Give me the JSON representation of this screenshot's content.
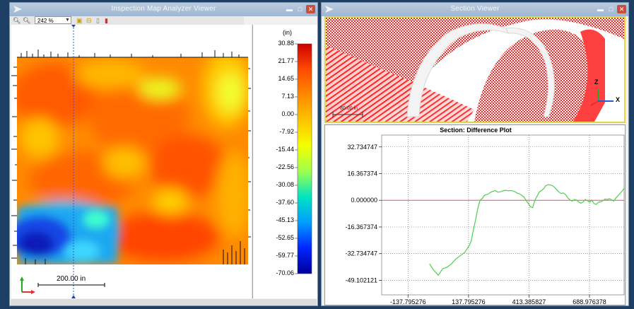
{
  "left_window": {
    "title": "Inspection Map Analyzer Viewer",
    "zoom_value": "242 %",
    "legend_unit": "(in)",
    "legend_ticks": [
      "30.88",
      "21.77",
      "14.65",
      "7.13",
      "0.00",
      "-7.92",
      "-15.44",
      "-22.56",
      "-30.08",
      "-37.60",
      "-45.13",
      "-52.65",
      "-59.77",
      "-70.06"
    ],
    "legend_colors": [
      "#cc0000",
      "#ff4a00",
      "#ff8a00",
      "#ffc400",
      "#f4ff00",
      "#9cff4f",
      "#00e3c2",
      "#009dff",
      "#0024ff",
      "#00009a"
    ],
    "scale_bar_label": "200.00 in"
  },
  "right_window": {
    "title": "Section Viewer",
    "view_scale_label": "80.00 in",
    "axis_z_label": "Z",
    "axis_x_label": "X",
    "plot": {
      "title": "Section: Difference Plot"
    }
  },
  "chart_data": {
    "type": "line",
    "title": "Section: Difference Plot",
    "xlabel": "",
    "ylabel": "",
    "x_ticks": [
      "-137.795276",
      "137.795276",
      "413.385827",
      "688.976378"
    ],
    "y_ticks": [
      "32.734747",
      "16.367374",
      "0.000000",
      "-16.367374",
      "-32.734747",
      "-49.102121"
    ],
    "xlim": [
      -258,
      850
    ],
    "ylim": [
      -58,
      40
    ],
    "series": [
      {
        "color": "#4dd04d",
        "x": [
          -40,
          -20,
          0,
          20,
          40,
          60,
          80,
          100,
          120,
          140,
          150,
          160,
          170,
          180,
          190,
          200,
          210,
          220,
          230,
          240,
          250,
          260,
          270,
          280,
          290,
          300,
          310,
          320,
          330,
          340,
          350,
          360,
          370,
          380,
          390,
          400,
          410,
          420,
          430,
          440,
          450,
          460,
          470,
          480,
          490,
          500,
          510,
          520,
          530,
          540,
          550,
          560,
          570,
          580,
          590,
          600,
          610,
          620,
          630,
          640,
          650,
          660,
          670,
          680,
          690,
          700,
          710,
          720,
          730,
          740,
          750,
          760,
          770,
          780,
          790,
          800,
          810,
          820,
          830,
          840,
          848
        ],
        "y": [
          -39,
          -43,
          -46,
          -42,
          -41,
          -39,
          -36,
          -34,
          -32,
          -28,
          -25,
          -18,
          -12,
          -5,
          0,
          1,
          3,
          3.5,
          4,
          5,
          5.5,
          6,
          5,
          5.2,
          5.5,
          6,
          6.1,
          5.8,
          6,
          5.7,
          5.2,
          4.3,
          4,
          3,
          2,
          0,
          -2,
          -4,
          -4.5,
          0,
          2.5,
          5,
          6,
          7,
          9,
          9.5,
          9.4,
          9,
          8,
          6.5,
          5,
          4.2,
          4.5,
          3.5,
          1.5,
          0.2,
          -0.5,
          0.5,
          0.1,
          -1,
          -1.8,
          -1,
          0.5,
          -0.3,
          -1.2,
          0,
          -2,
          -2.5,
          -1.2,
          -1,
          -0.3,
          0.8,
          0.4,
          1,
          0.3,
          -0.5,
          1.5,
          3,
          4.5,
          6,
          7.5
        ]
      }
    ],
    "reference_line": {
      "y": 0,
      "color": "#e0506a"
    }
  }
}
